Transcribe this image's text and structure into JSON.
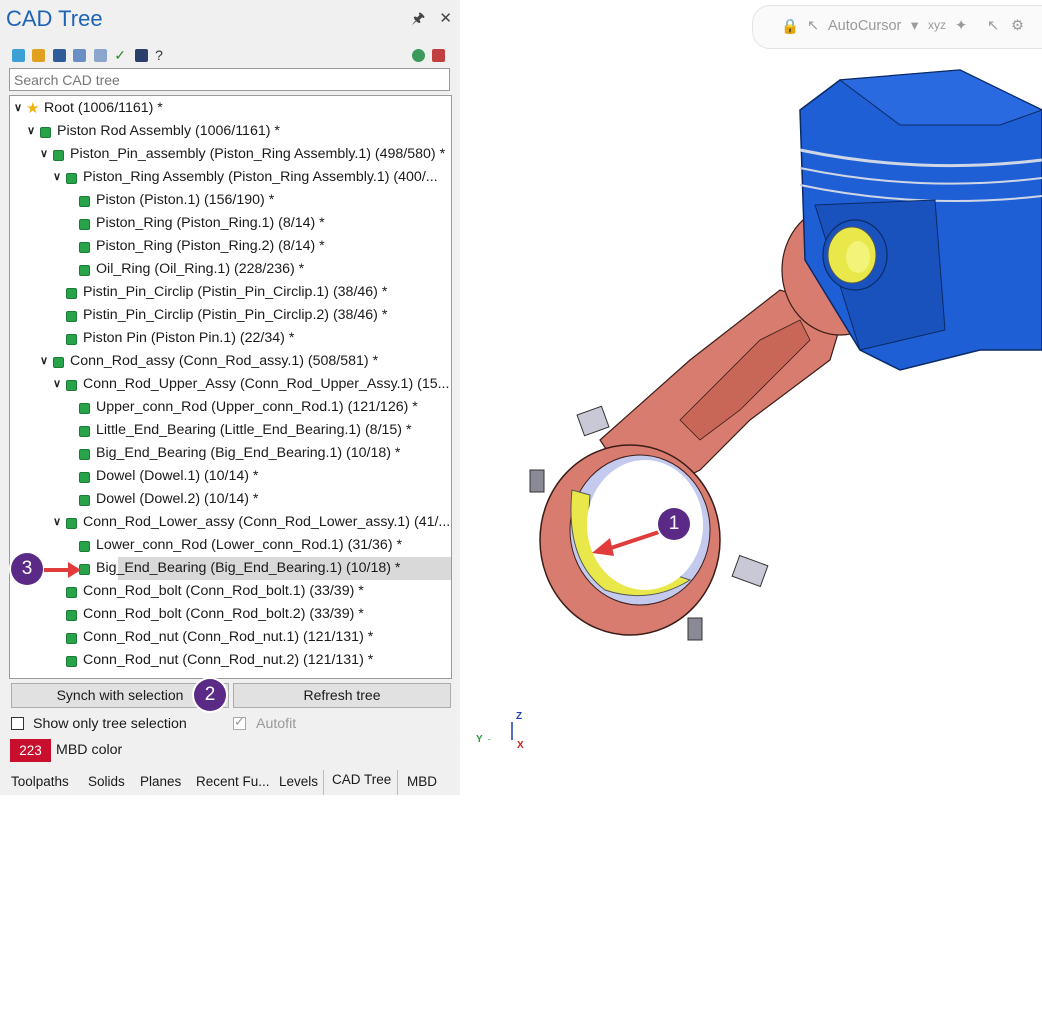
{
  "panel": {
    "title": "CAD Tree",
    "search_placeholder": "Search CAD tree",
    "tree": [
      {
        "label": "Root (1006/1161) *",
        "depth": 0,
        "icon": "star-icon",
        "expanded": true
      },
      {
        "label": "Piston Rod Assembly (1006/1161) *",
        "depth": 1,
        "icon": "part-icon",
        "expanded": true
      },
      {
        "label": "Piston_Pin_assembly (Piston_Ring Assembly.1) (498/580) *",
        "depth": 2,
        "icon": "part-icon",
        "expanded": true
      },
      {
        "label": "Piston_Ring Assembly (Piston_Ring Assembly.1) (400/...",
        "depth": 3,
        "icon": "part-icon",
        "expanded": true
      },
      {
        "label": "Piston (Piston.1) (156/190) *",
        "depth": 4,
        "icon": "part-icon"
      },
      {
        "label": "Piston_Ring (Piston_Ring.1) (8/14) *",
        "depth": 4,
        "icon": "part-icon"
      },
      {
        "label": "Piston_Ring (Piston_Ring.2) (8/14) *",
        "depth": 4,
        "icon": "part-icon"
      },
      {
        "label": "Oil_Ring (Oil_Ring.1) (228/236) *",
        "depth": 4,
        "icon": "part-icon"
      },
      {
        "label": "Pistin_Pin_Circlip (Pistin_Pin_Circlip.1) (38/46) *",
        "depth": 3,
        "icon": "part-icon"
      },
      {
        "label": "Pistin_Pin_Circlip (Pistin_Pin_Circlip.2) (38/46) *",
        "depth": 3,
        "icon": "part-icon"
      },
      {
        "label": "Piston Pin (Piston Pin.1) (22/34) *",
        "depth": 3,
        "icon": "part-icon"
      },
      {
        "label": "Conn_Rod_assy (Conn_Rod_assy.1) (508/581) *",
        "depth": 2,
        "icon": "part-icon",
        "expanded": true
      },
      {
        "label": "Conn_Rod_Upper_Assy (Conn_Rod_Upper_Assy.1) (15...",
        "depth": 3,
        "icon": "part-icon",
        "expanded": true
      },
      {
        "label": "Upper_conn_Rod (Upper_conn_Rod.1) (121/126) *",
        "depth": 4,
        "icon": "part-icon"
      },
      {
        "label": "Little_End_Bearing (Little_End_Bearing.1) (8/15) *",
        "depth": 4,
        "icon": "part-icon"
      },
      {
        "label": "Big_End_Bearing (Big_End_Bearing.1) (10/18) *",
        "depth": 4,
        "icon": "part-icon"
      },
      {
        "label": "Dowel (Dowel.1) (10/14) *",
        "depth": 4,
        "icon": "part-icon"
      },
      {
        "label": "Dowel (Dowel.2) (10/14) *",
        "depth": 4,
        "icon": "part-icon"
      },
      {
        "label": "Conn_Rod_Lower_assy (Conn_Rod_Lower_assy.1) (41/...",
        "depth": 3,
        "icon": "part-icon",
        "expanded": true
      },
      {
        "label": "Lower_conn_Rod (Lower_conn_Rod.1) (31/36) *",
        "depth": 4,
        "icon": "part-icon"
      },
      {
        "label": "Big_End_Bearing (Big_End_Bearing.1) (10/18) *",
        "depth": 4,
        "icon": "part-icon",
        "selected": true
      },
      {
        "label": "Conn_Rod_bolt (Conn_Rod_bolt.1) (33/39) *",
        "depth": 3,
        "icon": "part-icon"
      },
      {
        "label": "Conn_Rod_bolt (Conn_Rod_bolt.2) (33/39) *",
        "depth": 3,
        "icon": "part-icon"
      },
      {
        "label": "Conn_Rod_nut (Conn_Rod_nut.1) (121/131) *",
        "depth": 3,
        "icon": "part-icon"
      },
      {
        "label": "Conn_Rod_nut (Conn_Rod_nut.2) (121/131) *",
        "depth": 3,
        "icon": "part-icon"
      }
    ],
    "buttons": {
      "synch": "Synch with selection",
      "refresh": "Refresh tree"
    },
    "options": {
      "show_only_tree_selection": {
        "label": "Show only tree selection",
        "checked": false
      },
      "autofit": {
        "label": "Autofit",
        "checked": true,
        "disabled": true
      }
    },
    "mbd_color": {
      "value": "223",
      "label": "MBD color",
      "color": "#c8102e"
    },
    "tabs": [
      "Toolpaths",
      "Solids",
      "Planes",
      "Recent Fu...",
      "Levels",
      "CAD Tree",
      "MBD"
    ],
    "active_tab": "CAD Tree"
  },
  "viewport": {
    "toolbar": {
      "autocursor": "AutoCursor"
    },
    "axes": {
      "x": "X",
      "y": "Y",
      "z": "Z"
    }
  },
  "callouts": [
    "1",
    "2",
    "3"
  ],
  "colors": {
    "accent": "#1e63b5",
    "callout": "#5b2a86",
    "arrow": "#e03c3c",
    "piston": "#1f5fd6",
    "rod": "#d97c70",
    "bearing": "#e8e84a"
  }
}
